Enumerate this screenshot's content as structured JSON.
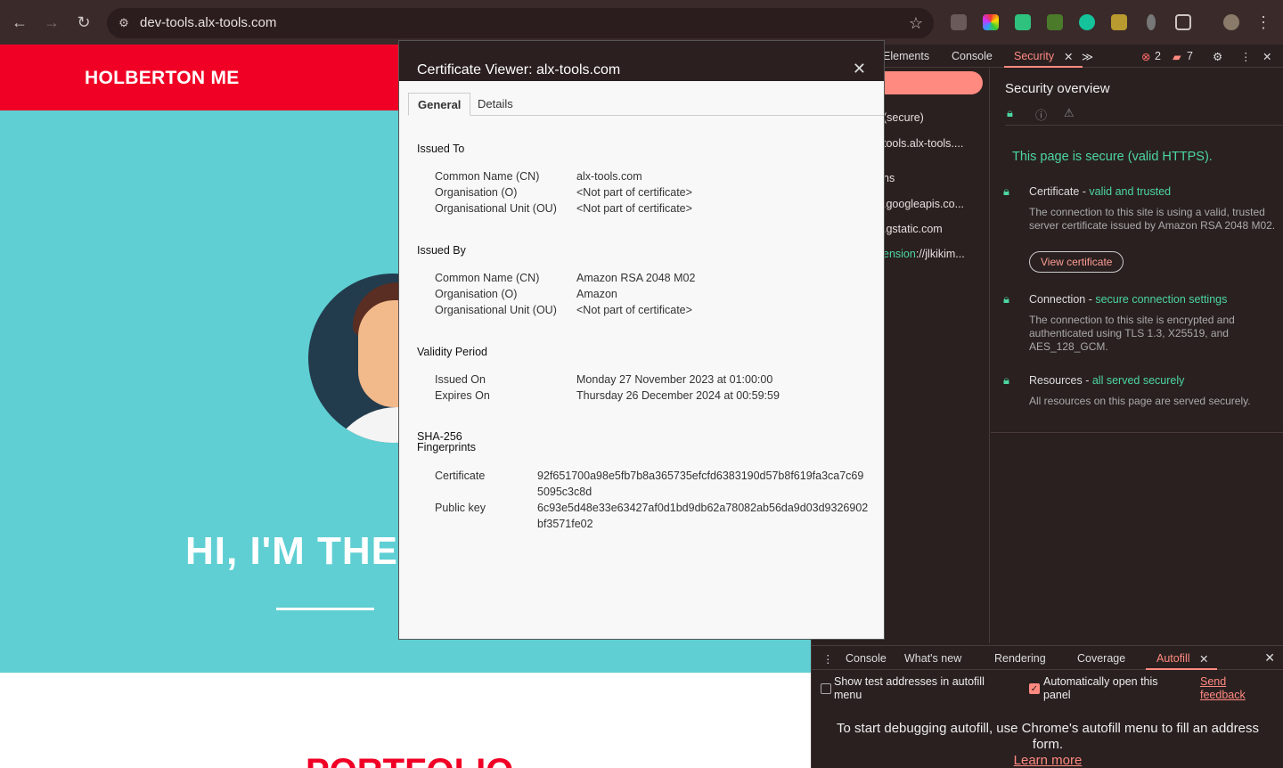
{
  "browser": {
    "url": "dev-tools.alx-tools.com",
    "back": "←",
    "forward": "→",
    "reload": "↻",
    "site_info_icon": "⚙",
    "star": "☆",
    "menu": "⋮"
  },
  "page": {
    "brand": "HOLBERTON ME",
    "hero_title": "HI, I'M THE",
    "section_title": "PORTFOLIO"
  },
  "cert_viewer": {
    "title": "Certificate Viewer: alx-tools.com",
    "close": "✕",
    "tabs": [
      "General",
      "Details"
    ],
    "issued_to": {
      "heading": "Issued To",
      "rows": [
        {
          "label": "Common Name (CN)",
          "value": "alx-tools.com"
        },
        {
          "label": "Organisation (O)",
          "value": "<Not part of certificate>"
        },
        {
          "label": "Organisational Unit (OU)",
          "value": "<Not part of certificate>"
        }
      ]
    },
    "issued_by": {
      "heading": "Issued By",
      "rows": [
        {
          "label": "Common Name (CN)",
          "value": "Amazon RSA 2048 M02"
        },
        {
          "label": "Organisation (O)",
          "value": "Amazon"
        },
        {
          "label": "Organisational Unit (OU)",
          "value": "<Not part of certificate>"
        }
      ]
    },
    "validity": {
      "heading": "Validity Period",
      "rows": [
        {
          "label": "Issued On",
          "value": "Monday 27 November 2023 at 01:00:00"
        },
        {
          "label": "Expires On",
          "value": "Thursday 26 December 2024 at 00:59:59"
        }
      ]
    },
    "fingerprints": {
      "heading_line1": "SHA-256",
      "heading_line2": "Fingerprints",
      "rows": [
        {
          "label": "Certificate",
          "value": "92f651700a98e5fb7b8a365735efcfd6383190d57b8f619fa3ca7c695095c3c8d"
        },
        {
          "label": "Public key",
          "value": "6c93e5d48e33e63427af0d1bd9db62a78082ab56da9d03d9326902bf3571fe02"
        }
      ]
    }
  },
  "devtools": {
    "tabs": {
      "elements": "Elements",
      "console": "Console",
      "security": "Security",
      "more": "≫"
    },
    "errors_count": "2",
    "messages_count": "7",
    "left_pane": [
      "(secure)",
      "tools.alx-tools....",
      "ns",
      ".googleapis.co...",
      ".gstatic.com",
      "ension://jlkikim..."
    ],
    "left_pane_ext_prefix": "ension",
    "left_pane_ext_rest": "://jlkikim...",
    "security_overview": {
      "title": "Security overview",
      "secure_text": "This page is secure (valid HTTPS).",
      "certificate": {
        "label": "Certificate - ",
        "accent": "valid and trusted",
        "desc": "The connection to this site is using a valid, trusted server certificate issued by Amazon RSA 2048 M02.",
        "button": "View certificate"
      },
      "connection": {
        "label": "Connection - ",
        "accent": "secure connection settings",
        "desc": "The connection to this site is encrypted and authenticated using TLS 1.3, X25519, and AES_128_GCM."
      },
      "resources": {
        "label": "Resources - ",
        "accent": "all served securely",
        "desc": "All resources on this page are served securely."
      }
    },
    "drawer": {
      "tabs": [
        "Console",
        "What's new",
        "Rendering",
        "Coverage",
        "Autofill"
      ],
      "show_test_addresses": "Show test addresses in autofill menu",
      "auto_open": "Automatically open this panel",
      "send_feedback": "Send feedback",
      "message": "To start debugging autofill, use Chrome's autofill menu to fill an address form.",
      "learn_more": "Learn more"
    }
  },
  "colors": {
    "brand_red": "#f00025",
    "hero_teal": "#5fcfd3",
    "devtools_accent": "#ff8a80",
    "secure_green": "#4cd6a0"
  }
}
